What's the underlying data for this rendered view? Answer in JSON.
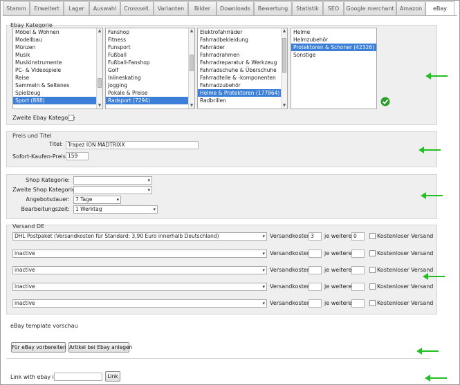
{
  "tabs": [
    {
      "label": "Stamm"
    },
    {
      "label": "Erweitert"
    },
    {
      "label": "Lager"
    },
    {
      "label": "Auswahl"
    },
    {
      "label": "Crosssell."
    },
    {
      "label": "Varianten"
    },
    {
      "label": "Bilder"
    },
    {
      "label": "Downloads"
    },
    {
      "label": "Bewertung"
    },
    {
      "label": "Statistik"
    },
    {
      "label": "SEO"
    },
    {
      "label": "Google merchant"
    },
    {
      "label": "Amazon"
    },
    {
      "label": "eBay"
    }
  ],
  "ebay_kategorie": {
    "legend": "Ebay Kategorie",
    "list1": [
      "Möbel & Wohnen",
      "Modellbau",
      "Münzen",
      "Musik",
      "Musikinstrumente",
      "PC- & Videospiele",
      "Reise",
      "Sammeln & Seltenes",
      "Spielzeug",
      "Sport (888)"
    ],
    "list2": [
      "Fanshop",
      "Fitness",
      "Funsport",
      "Fußball",
      "Fußball-Fanshop",
      "Golf",
      "Inlineskating",
      "Jogging",
      "Pokale & Preise",
      "Radsport (7294)"
    ],
    "list3": [
      "Elektrofahrräder",
      "Fahrradbekleidung",
      "Fahrräder",
      "Fahrradrahmen",
      "Fahrradreparatur & Werkzeug",
      "Fahrradschuhe & Überschuhe",
      "Fahrradteile & -komponenten",
      "Fahrradzubehör",
      "Helme & Protektoren (177864)",
      "Radbrillen"
    ],
    "list4": [
      "Helme",
      "Helmzubehör",
      "Protektoren & Schoner (42326)",
      "Sonstige"
    ],
    "zweite_label": "Zweite Ebay Kategorie"
  },
  "preis": {
    "legend": "Preis und Titel",
    "titel_label": "Titel:",
    "titel_value": "Trapez ION MADTRIXX",
    "sofort_label": "Sofort-Kaufen-Preis:",
    "sofort_value": "159"
  },
  "shop": {
    "shop_kat_label": "Shop Kategorie:",
    "zweite_shop_label": "Zweite Shop Kategorie:",
    "angebot_label": "Angebotsdauer:",
    "angebot_value": "7 Tage",
    "bearb_label": "Bearbeitungszeit:",
    "bearb_value": "1 Werktag"
  },
  "versand": {
    "legend": "Versand DE",
    "kosten_label": "Versandkosten:",
    "weitere_label": "je weitere",
    "kostenlos_label": "Kostenloser Versand",
    "rows": [
      {
        "service": "DHL Postpaket (Versandkosten für Standard: 3,90 Euro innerhalb Deutschland)",
        "kosten": "3",
        "weitere": "0"
      },
      {
        "service": "inactive",
        "kosten": "",
        "weitere": ""
      },
      {
        "service": "inactive",
        "kosten": "",
        "weitere": ""
      },
      {
        "service": "inactive",
        "kosten": "",
        "weitere": ""
      },
      {
        "service": "inactive",
        "kosten": "",
        "weitere": ""
      }
    ]
  },
  "template": {
    "vorschau_label": "eBay template vorschau",
    "btn_vorbereiten": "Für eBay vorbereiten",
    "btn_anlegen": "Artikel bei Ebay anlegen"
  },
  "link": {
    "label": "Link with ebay id:",
    "value": "",
    "button": "Link"
  },
  "colors": {
    "selection": "#3c7fd9",
    "section_bg": "#efefef",
    "arrow": "#22c022",
    "check_ok": "#2a9d2a"
  }
}
